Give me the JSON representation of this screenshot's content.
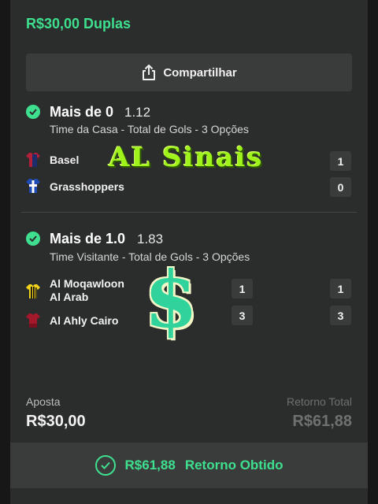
{
  "header": {
    "amount_type": "R$30,00 Duplas"
  },
  "share_button": {
    "label": "Compartilhar",
    "icon": "share-icon"
  },
  "bets": [
    {
      "market": "Mais de 0",
      "odd": "1.12",
      "subtitle": "Time da Casa - Total de Gols - 3 Opções",
      "teams": [
        {
          "name": "Basel",
          "score": "1",
          "shirt_colors": [
            "#b11f3a",
            "#1b2d6b"
          ]
        },
        {
          "name": "Grasshoppers",
          "score": "0",
          "shirt_colors": [
            "#1f4bb5",
            "#ffffff"
          ]
        }
      ]
    },
    {
      "market": "Mais de 1.0",
      "odd": "1.83",
      "subtitle": "Time Visitante - Total de Gols - 3 Opções",
      "teams": [
        {
          "name": "Al Moqawloon Al Arab",
          "name_line1": "Al Moqawloon",
          "name_line2": "Al Arab",
          "score_left": "1",
          "score": "1",
          "shirt_colors": [
            "#f2d21b",
            "#111111"
          ]
        },
        {
          "name": "Al Ahly Cairo",
          "score_left": "3",
          "score": "3",
          "shirt_colors": [
            "#a3182a",
            "#7a0f1f"
          ]
        }
      ]
    }
  ],
  "overlay": {
    "watermark_text": "AL Sinais",
    "dollar_symbol": "$"
  },
  "summary": {
    "stake_label": "Aposta",
    "stake_value": "R$30,00",
    "return_label": "Retorno Total",
    "return_value": "R$61,88"
  },
  "footer": {
    "amount": "R$61,88",
    "label": "Retorno Obtido",
    "icon": "check-circle-icon"
  },
  "colors": {
    "accent": "#3ee08f",
    "background": "#2b2c2c",
    "button": "#3a3b3b"
  }
}
